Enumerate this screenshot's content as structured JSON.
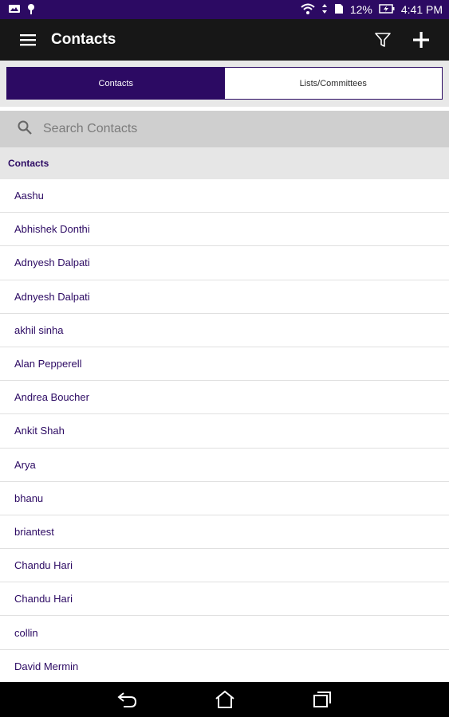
{
  "status_bar": {
    "battery": "12%",
    "time": "4:41 PM",
    "icons": [
      "image-notification-icon",
      "location-pin-icon",
      "wifi-icon",
      "signal-arrows-icon",
      "sim-card-icon",
      "battery-charging-icon"
    ]
  },
  "app_bar": {
    "title": "Contacts",
    "icons": [
      "menu-icon",
      "filter-icon",
      "add-icon"
    ]
  },
  "tabs": [
    {
      "label": "Contacts",
      "active": true
    },
    {
      "label": "Lists/Committees",
      "active": false
    }
  ],
  "search": {
    "placeholder": "Search Contacts",
    "value": ""
  },
  "section_header": "Contacts",
  "contacts": [
    "Aashu",
    "Abhishek Donthi",
    "Adnyesh Dalpati",
    "Adnyesh Dalpati",
    "akhil sinha",
    "Alan Pepperell",
    "Andrea Boucher",
    "Ankit Shah",
    "Arya",
    "bhanu",
    "briantest",
    "Chandu Hari",
    "Chandu Hari",
    "collin",
    "David Mermin"
  ],
  "nav_bar": {
    "icons": [
      "back-icon",
      "home-icon",
      "recent-apps-icon"
    ]
  },
  "colors": {
    "accent": "#2c0a63",
    "app_bar": "#171717",
    "search_bg": "#cfcfcf"
  }
}
